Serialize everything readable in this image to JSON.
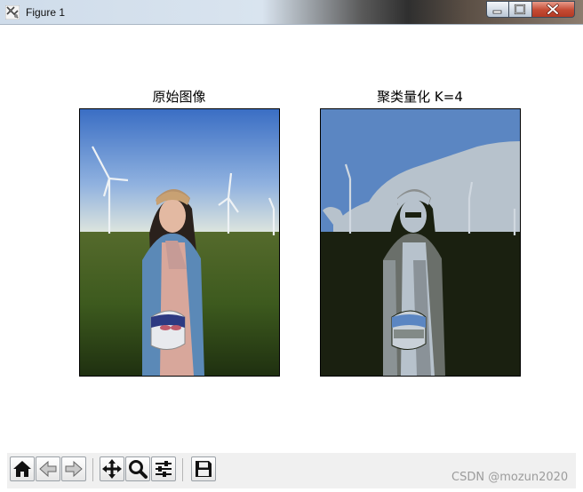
{
  "window": {
    "title": "Figure 1",
    "title_bar_gradient": [
      "#cfdcea",
      "#2f2f2f"
    ]
  },
  "figure": {
    "left_title": "原始图像",
    "right_title": "聚类量化 K=4"
  },
  "toolbar": {
    "buttons": [
      "home-icon",
      "back-arrow-icon",
      "forward-arrow-icon",
      "pan-icon",
      "zoom-icon",
      "configure-subplots-icon",
      "save-icon"
    ]
  },
  "watermark": "CSDN @mozun2020",
  "colors": {
    "original_sky_top": "#3a6ec4",
    "original_sky_bottom": "#d9e3df",
    "original_grass": "#3d5a1e",
    "quantized_sky": "#5b86c2",
    "quantized_cloud": "#b7c2cc",
    "quantized_dark": "#1a2010"
  }
}
